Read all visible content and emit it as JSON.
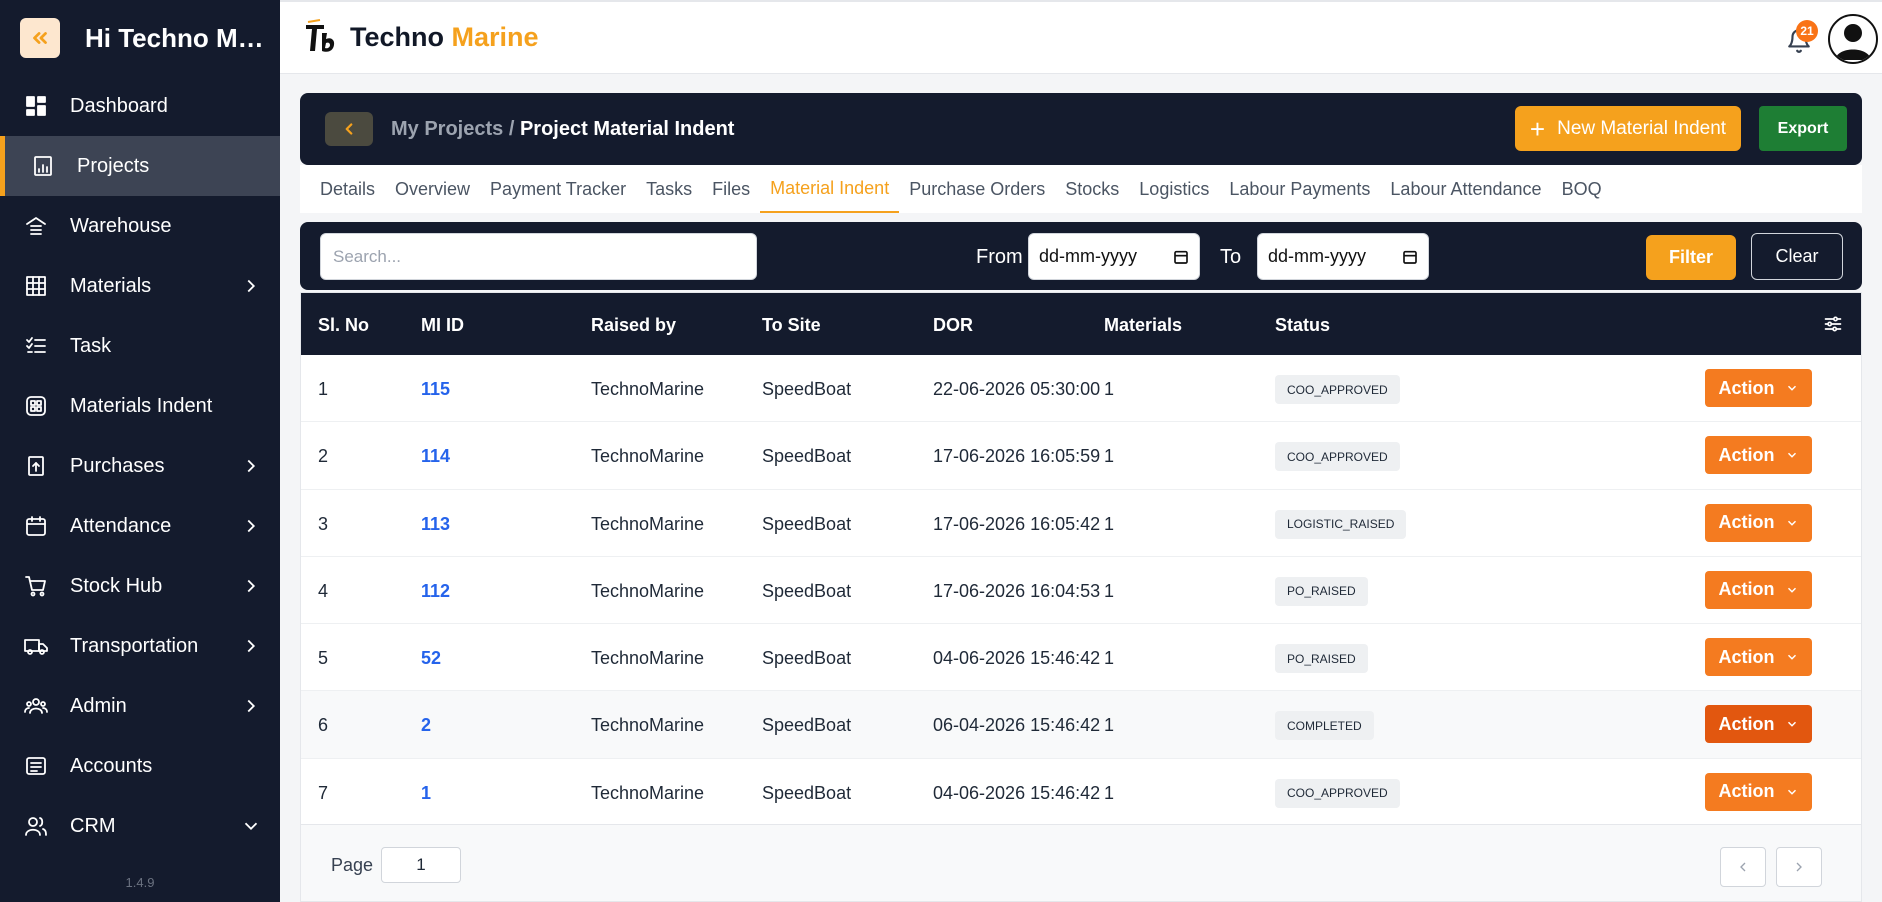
{
  "sidebar": {
    "greeting": "Hi Techno Mar...",
    "version": "1.4.9",
    "items": [
      {
        "label": "Dashboard",
        "icon": "dashboard-icon"
      },
      {
        "label": "Projects",
        "icon": "projects-icon",
        "active": true
      },
      {
        "label": "Warehouse",
        "icon": "warehouse-icon"
      },
      {
        "label": "Materials",
        "icon": "grid-icon",
        "expand": true
      },
      {
        "label": "Task",
        "icon": "checklist-icon"
      },
      {
        "label": "Materials Indent",
        "icon": "materials-indent-icon"
      },
      {
        "label": "Purchases",
        "icon": "purchases-icon",
        "expand": true
      },
      {
        "label": "Attendance",
        "icon": "calendar-icon",
        "expand": true
      },
      {
        "label": "Stock Hub",
        "icon": "cart-icon",
        "expand": true
      },
      {
        "label": "Transportation",
        "icon": "truck-icon",
        "expand": true
      },
      {
        "label": "Admin",
        "icon": "users-icon",
        "expand": true
      },
      {
        "label": "Accounts",
        "icon": "accounts-icon"
      },
      {
        "label": "CRM",
        "icon": "crm-icon",
        "expand_down": true
      }
    ]
  },
  "topbar": {
    "brand_part1": "Techno",
    "brand_part2": "Marine",
    "notification_count": "21"
  },
  "header": {
    "breadcrumb_parent": "My Projects /",
    "breadcrumb_current": "Project Material Indent",
    "new_button": "New Material Indent",
    "export_button": "Export"
  },
  "tabs": [
    {
      "label": "Details"
    },
    {
      "label": "Overview"
    },
    {
      "label": "Payment Tracker"
    },
    {
      "label": "Tasks"
    },
    {
      "label": "Files"
    },
    {
      "label": "Material Indent",
      "active": true
    },
    {
      "label": "Purchase Orders"
    },
    {
      "label": "Stocks"
    },
    {
      "label": "Logistics"
    },
    {
      "label": "Labour Payments"
    },
    {
      "label": "Labour Attendance"
    },
    {
      "label": "BOQ"
    }
  ],
  "filter": {
    "search_placeholder": "Search...",
    "from_label": "From",
    "to_label": "To",
    "from_value": "dd-mm-yyyy",
    "to_value": "dd-mm-yyyy",
    "filter_button": "Filter",
    "clear_button": "Clear"
  },
  "table": {
    "columns": [
      "Sl. No",
      "MI ID",
      "Raised by",
      "To Site",
      "DOR",
      "Materials",
      "Status"
    ],
    "action_label": "Action",
    "rows": [
      {
        "sl": "1",
        "mi": "115",
        "raised_by": "TechnoMarine",
        "site": "SpeedBoat",
        "dor": "22-06-2026 05:30:00",
        "materials": "1",
        "status": "COO_APPROVED"
      },
      {
        "sl": "2",
        "mi": "114",
        "raised_by": "TechnoMarine",
        "site": "SpeedBoat",
        "dor": "17-06-2026 16:05:59",
        "materials": "1",
        "status": "COO_APPROVED"
      },
      {
        "sl": "3",
        "mi": "113",
        "raised_by": "TechnoMarine",
        "site": "SpeedBoat",
        "dor": "17-06-2026 16:05:42",
        "materials": "1",
        "status": "LOGISTIC_RAISED"
      },
      {
        "sl": "4",
        "mi": "112",
        "raised_by": "TechnoMarine",
        "site": "SpeedBoat",
        "dor": "17-06-2026 16:04:53",
        "materials": "1",
        "status": "PO_RAISED"
      },
      {
        "sl": "5",
        "mi": "52",
        "raised_by": "TechnoMarine",
        "site": "SpeedBoat",
        "dor": "04-06-2026 15:46:42",
        "materials": "1",
        "status": "PO_RAISED"
      },
      {
        "sl": "6",
        "mi": "2",
        "raised_by": "TechnoMarine",
        "site": "SpeedBoat",
        "dor": "06-04-2026 15:46:42",
        "materials": "1",
        "status": "COMPLETED",
        "hover": true
      },
      {
        "sl": "7",
        "mi": "1",
        "raised_by": "TechnoMarine",
        "site": "SpeedBoat",
        "dor": "04-06-2026 15:46:42",
        "materials": "1",
        "status": "COO_APPROVED"
      }
    ]
  },
  "pager": {
    "page_label": "Page",
    "page_value": "1"
  },
  "colors": {
    "sidebar_bg": "#141b2d",
    "accent": "#f5a11d",
    "action": "#f47b20",
    "export": "#1e7e34",
    "link": "#2563eb"
  }
}
